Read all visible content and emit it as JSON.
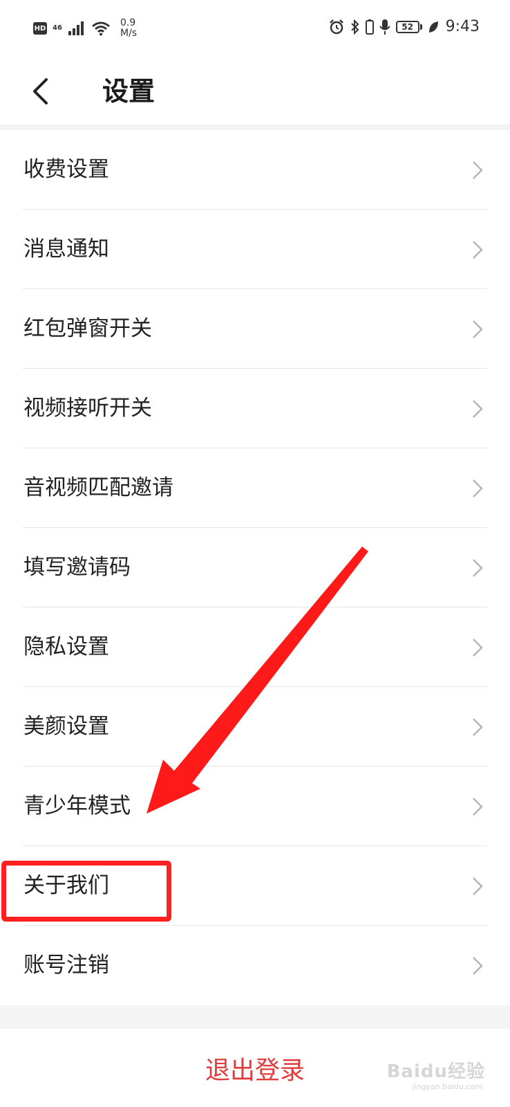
{
  "status_bar": {
    "hd_label": "HD",
    "network_type": "46",
    "speed_value": "0.9",
    "speed_unit": "M/s",
    "battery_level": "52",
    "time": "9:43",
    "icons": [
      "signal-icon",
      "wifi-icon",
      "alarm-icon",
      "bluetooth-icon",
      "microphone-icon",
      "battery-icon",
      "leaf-icon"
    ]
  },
  "header": {
    "title": "设置",
    "back_icon": "chevron-left-icon"
  },
  "menu": {
    "items": [
      {
        "label": "收费设置"
      },
      {
        "label": "消息通知"
      },
      {
        "label": "红包弹窗开关"
      },
      {
        "label": "视频接听开关"
      },
      {
        "label": "音视频匹配邀请"
      },
      {
        "label": "填写邀请码"
      },
      {
        "label": "隐私设置"
      },
      {
        "label": "美颜设置"
      },
      {
        "label": "青少年模式"
      },
      {
        "label": "关于我们"
      },
      {
        "label": "账号注销"
      }
    ]
  },
  "logout": {
    "label": "退出登录"
  },
  "watermark": {
    "brand": "Baidu经验",
    "url": "jingyan.baidu.com"
  },
  "colors": {
    "logout_text": "#e23b3b",
    "annotation": "#ff2020",
    "divider": "#e6e6e6",
    "background_band": "#f4f4f4"
  }
}
